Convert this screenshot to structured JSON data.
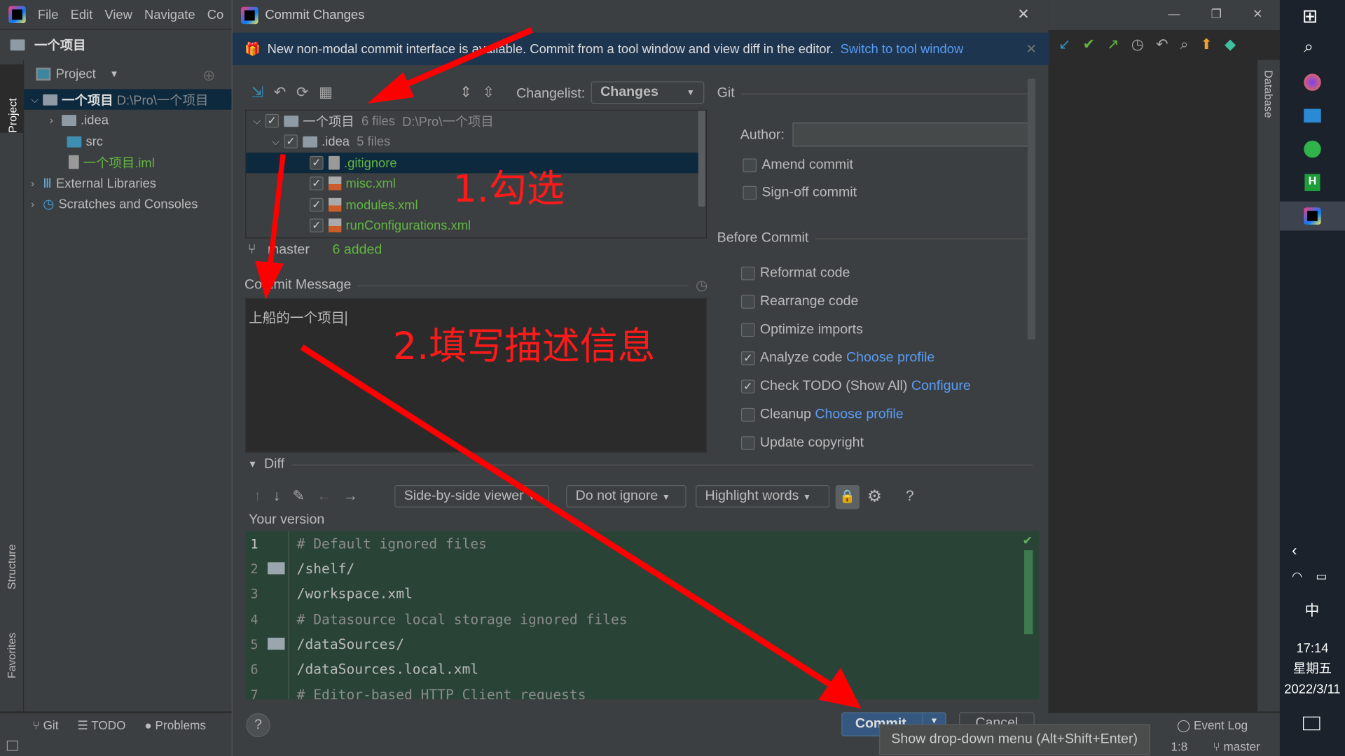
{
  "ide": {
    "menu": [
      "File",
      "Edit",
      "View",
      "Navigate",
      "Co"
    ],
    "project_name": "一个项目",
    "project_tab": "Project",
    "tree": [
      {
        "label": "一个项目",
        "path": "D:\\Pro\\一个项目"
      },
      {
        "label": ".idea"
      },
      {
        "label": "src"
      },
      {
        "label": "一个项目.iml"
      },
      {
        "label": "External Libraries"
      },
      {
        "label": "Scratches and Consoles"
      }
    ],
    "left_tool_windows": [
      "Project",
      "Structure",
      "Favorites"
    ],
    "bottom_tabs": [
      "Git",
      "TODO",
      "Problems"
    ],
    "right_tool_window": "Database",
    "status": {
      "event_log": "Event Log",
      "position": "1:8",
      "branch": "master"
    }
  },
  "dialog": {
    "title": "Commit Changes",
    "banner": {
      "text": "New non-modal commit interface is available. Commit from a tool window and view diff in the editor.",
      "link": "Switch to tool window"
    },
    "changelist_label": "Changelist:",
    "changelist_value": "Changes",
    "changes_tree": [
      {
        "name": "一个项目",
        "meta": "6 files",
        "path": "D:\\Pro\\一个项目",
        "checked": true
      },
      {
        "name": ".idea",
        "meta": "5 files",
        "checked": true
      },
      {
        "name": ".gitignore",
        "checked": true,
        "selected": true
      },
      {
        "name": "misc.xml",
        "checked": true
      },
      {
        "name": "modules.xml",
        "checked": true
      },
      {
        "name": "runConfigurations.xml",
        "checked": true
      }
    ],
    "branch": "master",
    "added": "6 added",
    "commit_message_label": "Commit Message",
    "commit_message": "上船的一个项目",
    "git_section": "Git",
    "author_label": "Author:",
    "author_value": "",
    "git_options": [
      {
        "label": "Amend commit",
        "checked": false
      },
      {
        "label": "Sign-off commit",
        "checked": false
      }
    ],
    "before_commit_section": "Before Commit",
    "before_commit": [
      {
        "label": "Reformat code",
        "checked": false
      },
      {
        "label": "Rearrange code",
        "checked": false
      },
      {
        "label": "Optimize imports",
        "checked": false
      },
      {
        "label": "Analyze code",
        "link": "Choose profile",
        "checked": true
      },
      {
        "label": "Check TODO (Show All)",
        "link": "Configure",
        "checked": true
      },
      {
        "label": "Cleanup",
        "link": "Choose profile",
        "checked": false
      },
      {
        "label": "Update copyright",
        "checked": false
      }
    ],
    "diff": {
      "title": "Diff",
      "viewer": "Side-by-side viewer",
      "ignore": "Do not ignore",
      "highlight": "Highlight words",
      "version_label": "Your version",
      "lines": [
        {
          "n": "1",
          "t": "# Default ignored files"
        },
        {
          "n": "2",
          "t": "/shelf/"
        },
        {
          "n": "3",
          "t": "/workspace.xml"
        },
        {
          "n": "4",
          "t": "# Datasource local storage ignored files"
        },
        {
          "n": "5",
          "t": "/dataSources/"
        },
        {
          "n": "6",
          "t": "/dataSources.local.xml"
        },
        {
          "n": "7",
          "t": "# Editor-based HTTP Client requests"
        }
      ]
    },
    "commit_button": "Commit",
    "cancel_button": "Cancel",
    "help": "?",
    "tooltip": "Show drop-down menu (Alt+Shift+Enter)"
  },
  "annotations": {
    "step1": "1.勾选",
    "step2": "2.填写描述信息",
    "color": "#ff0000"
  },
  "taskbar": {
    "time": "17:14",
    "weekday": "星期五",
    "date": "2022/3/11",
    "ime": "中"
  }
}
